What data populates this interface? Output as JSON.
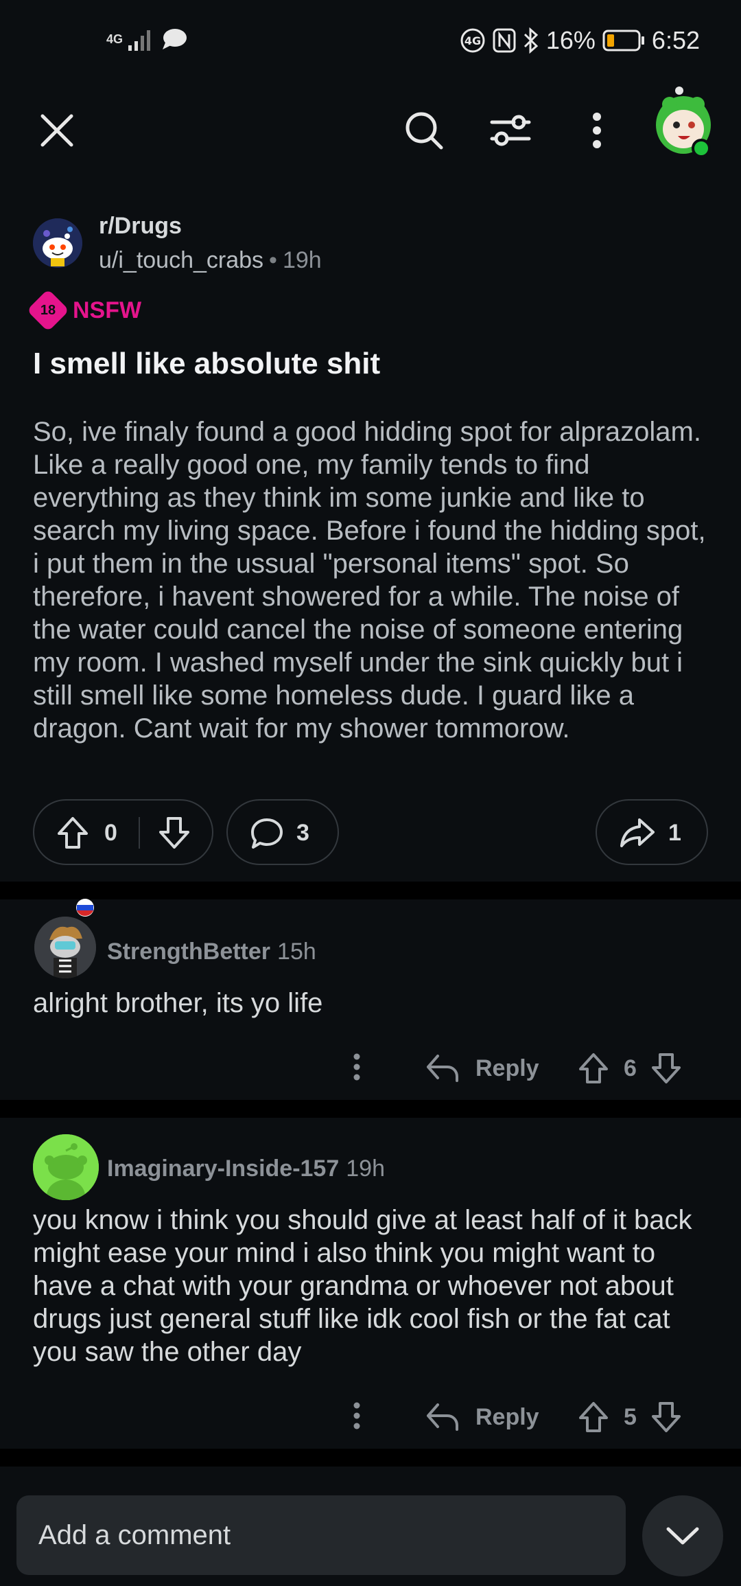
{
  "status_bar": {
    "network": "4G",
    "battery": "16%",
    "time": "6:52"
  },
  "toolbar": {
    "icons": [
      "close-icon",
      "search-icon",
      "sort-icon",
      "more-icon",
      "profile-avatar"
    ]
  },
  "post": {
    "subreddit": "r/Drugs",
    "author": "u/i_touch_crabs",
    "age": "19h",
    "nsfw_badge": "18",
    "nsfw_label": "NSFW",
    "title": "I smell like absolute shit",
    "body": "So, ive finaly found a good hidding spot for alprazolam. Like a really good one, my family tends to find everything as they think im some junkie and like to search my living space. Before i found the hidding spot, i put them in the ussual \"personal items\" spot. So therefore, i havent showered for a while. The noise of the water could cancel the noise of someone entering my room. I washed myself under the sink quickly but i still smell like some homeless dude. I guard like a dragon. Cant wait for my shower tommorow.",
    "score": "0",
    "comments": "3",
    "shares": "1"
  },
  "comments": [
    {
      "user": "StrengthBetter",
      "age": "15h",
      "text": "alright brother, its yo life",
      "reply_label": "Reply",
      "score": "6"
    },
    {
      "user": "Imaginary-Inside-157",
      "age": "19h",
      "text": "you know i think you should give at least half of it back might ease your mind i also think you might want to have a chat with your grandma or whoever not about drugs just general stuff like idk cool fish or the fat cat you saw the other day",
      "reply_label": "Reply",
      "score": "5"
    }
  ],
  "composer": {
    "placeholder": "Add a comment"
  },
  "colors": {
    "background": "#0b0e11",
    "nsfw": "#e5148c",
    "online": "#1dc23a"
  }
}
